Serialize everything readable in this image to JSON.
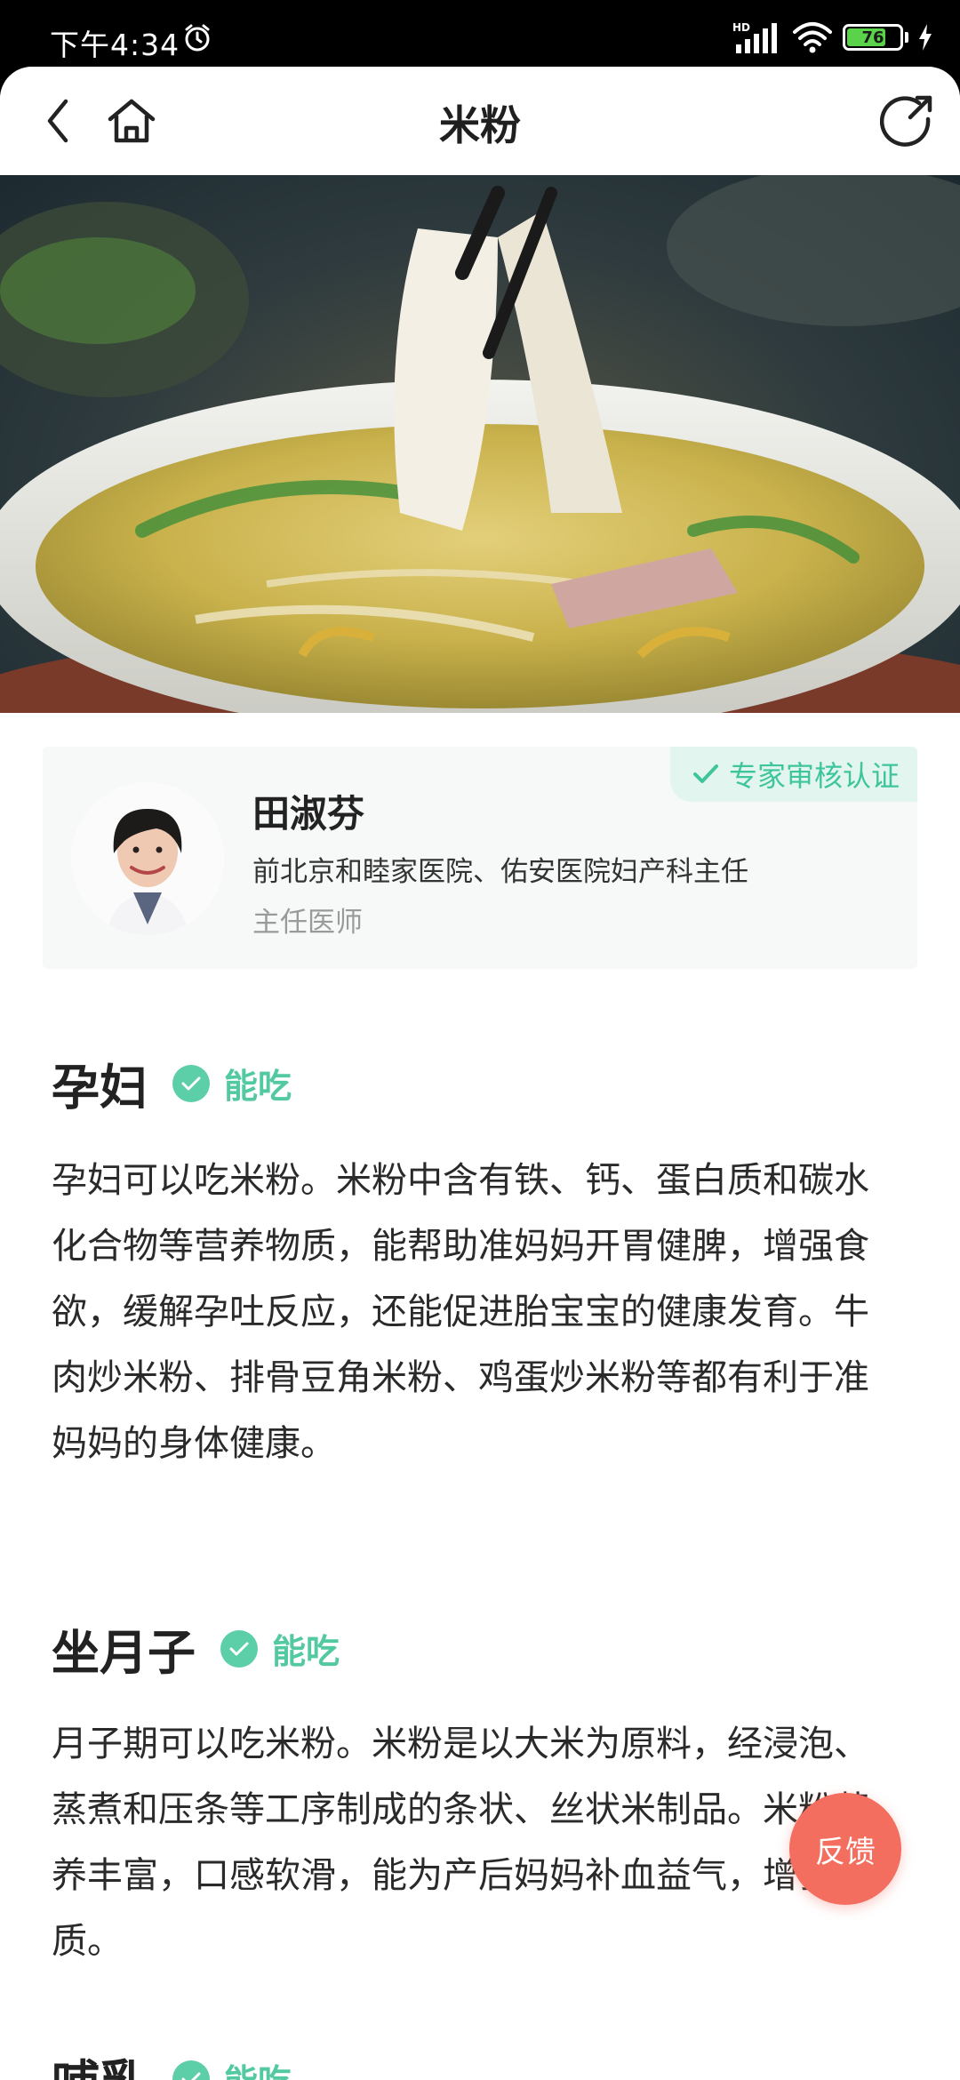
{
  "status_bar": {
    "time": "下午4:34",
    "network_label": "HD",
    "battery_level": "76"
  },
  "nav": {
    "title": "米粉"
  },
  "expert": {
    "badge": "专家审核认证",
    "name": "田淑芬",
    "hospital": "前北京和睦家医院、佑安医院妇产科主任",
    "title": "主任医师"
  },
  "sections": [
    {
      "title": "孕妇",
      "verdict": "能吃",
      "body": "孕妇可以吃米粉。米粉中含有铁、钙、蛋白质和碳水化合物等营养物质，能帮助准妈妈开胃健脾，增强食欲，缓解孕吐反应，还能促进胎宝宝的健康发育。牛肉炒米粉、排骨豆角米粉、鸡蛋炒米粉等都有利于准妈妈的身体健康。"
    },
    {
      "title": "坐月子",
      "verdict": "能吃",
      "body": "月子期可以吃米粉。米粉是以大米为原料，经浸泡、蒸煮和压条等工序制成的条状、丝状米制品。米粉营养丰富，口感软滑，能为产后妈妈补血益气，增强体质。"
    },
    {
      "title": "哺乳",
      "verdict": "能吃"
    }
  ],
  "feedback_label": "反馈",
  "colors": {
    "accent_green": "#52c9a0",
    "feedback_red": "#f36e5e",
    "battery_green": "#5ad34a"
  }
}
